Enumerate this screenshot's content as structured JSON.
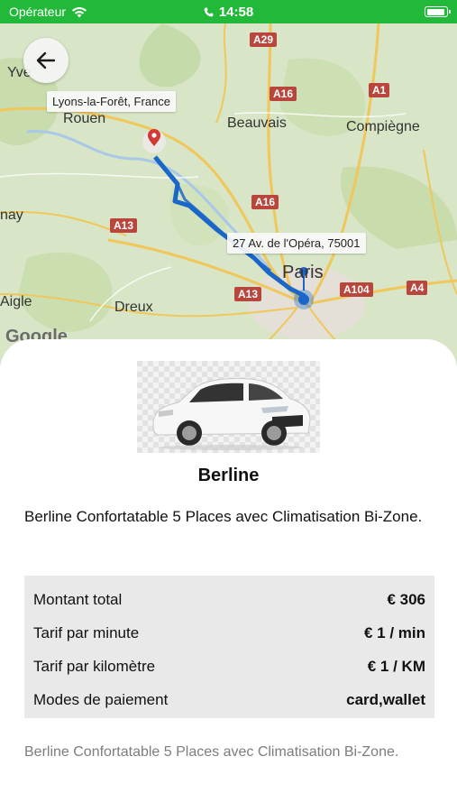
{
  "status_bar": {
    "carrier": "Opérateur",
    "time": "14:58",
    "battery_level": 0.95
  },
  "map": {
    "back_icon": "arrow-left-icon",
    "origin_label": "Lyons-la-Forêt, France",
    "destination_label": "27 Av. de l'Opéra, 75001",
    "places": {
      "yve": "Yve",
      "rouen": "Rouen",
      "beauvais": "Beauvais",
      "compiegne": "Compiègne",
      "nay": "nay",
      "aigle": "Aigle",
      "dreux": "Dreux",
      "paris": "Paris"
    },
    "roads": {
      "a29": "A29",
      "a16_top": "A16",
      "a1": "A1",
      "a16_mid": "A16",
      "a13_left": "A13",
      "a13_bottom": "A13",
      "a104": "A104",
      "a4": "A4"
    },
    "google_logo": "Google",
    "route_color": "#1a66c9",
    "pin_color": "#d23a33"
  },
  "vehicle": {
    "title": "Berline",
    "description": "Berline Confortatable 5 Places avec Climatisation Bi-Zone."
  },
  "pricing": {
    "rows": [
      {
        "label": "Montant total",
        "value": "€ 306"
      },
      {
        "label": "Tarif par minute",
        "value": "€ 1 / min"
      },
      {
        "label": "Tarif par kilomètre",
        "value": "€ 1 / KM"
      },
      {
        "label": "Modes de paiement",
        "value": "card,wallet"
      }
    ]
  },
  "footer_description": "Berline Confortatable 5 Places avec Climatisation Bi-Zone.",
  "colors": {
    "status_bar": "#22b93a",
    "table_bg": "#e9e9e9",
    "muted_text": "#7d7d7d"
  }
}
